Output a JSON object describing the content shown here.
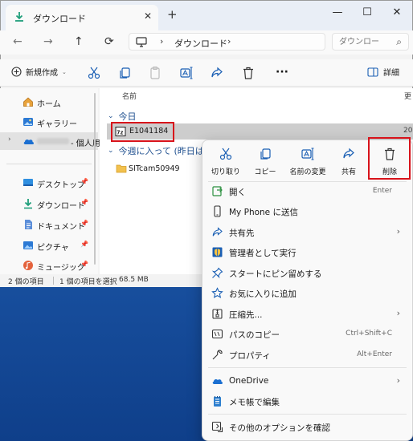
{
  "window": {
    "tab_title": "ダウンロード",
    "tab_close": "✕",
    "new_tab": "+",
    "controls": {
      "minimize": "—",
      "maximize": "☐",
      "close": "✕"
    }
  },
  "address": {
    "nav": {
      "back": "←",
      "forward": "→",
      "up": "↑",
      "refresh": "⟳"
    },
    "separator": "›",
    "crumb": "ダウンロード",
    "search_placeholder": "ダウンロー",
    "search_icon": "⌕"
  },
  "toolbar": {
    "new_label": "新規作成",
    "new_chevron": "⌄",
    "more": "···",
    "details_label": "詳細"
  },
  "nav_pane": {
    "home": "ホーム",
    "gallery": "ギャラリー",
    "cloud_suffix": "- 個人用",
    "cloud_expander": "›",
    "desktop": "デスクトップ",
    "downloads": "ダウンロード",
    "documents": "ドキュメント",
    "pictures": "ピクチャ",
    "music": "ミュージック",
    "pin": "📌"
  },
  "files": {
    "col_name": "名前",
    "col_date": "更",
    "group_today": "今日",
    "group_this_week": "今週に入って (昨日は",
    "group_chevron": "⌄",
    "items": [
      {
        "name": "E1041184",
        "date": "20"
      },
      {
        "name": "SITcam50949"
      }
    ]
  },
  "status": {
    "count": "2 個の項目",
    "selected": "1 個の項目を選択",
    "size": "68.5 MB"
  },
  "context_menu": {
    "quick": [
      {
        "label": "切り取り",
        "icon": "cut-icon"
      },
      {
        "label": "コピー",
        "icon": "copy-icon"
      },
      {
        "label": "名前の変更",
        "icon": "rename-icon"
      },
      {
        "label": "共有",
        "icon": "share-icon"
      },
      {
        "label": "削除",
        "icon": "delete-icon"
      }
    ],
    "items": [
      {
        "label": "開く",
        "shortcut": "Enter"
      },
      {
        "label": "My Phone に送信"
      },
      {
        "label": "共有先",
        "arrow": "›"
      },
      {
        "label": "管理者として実行"
      },
      {
        "label": "スタートにピン留めする"
      },
      {
        "label": "お気に入りに追加"
      },
      {
        "label": "圧縮先...",
        "arrow": "›"
      },
      {
        "label": "パスのコピー",
        "shortcut": "Ctrl+Shift+C"
      },
      {
        "label": "プロパティ",
        "shortcut": "Alt+Enter"
      },
      {
        "label": "OneDrive",
        "arrow": "›"
      },
      {
        "label": "メモ帳で編集"
      },
      {
        "label": "その他のオプションを確認"
      }
    ]
  },
  "colors": {
    "highlight_red": "#d8131b",
    "accent_blue": "#1e4f8f",
    "desktop_blue": "#1c57a8"
  }
}
